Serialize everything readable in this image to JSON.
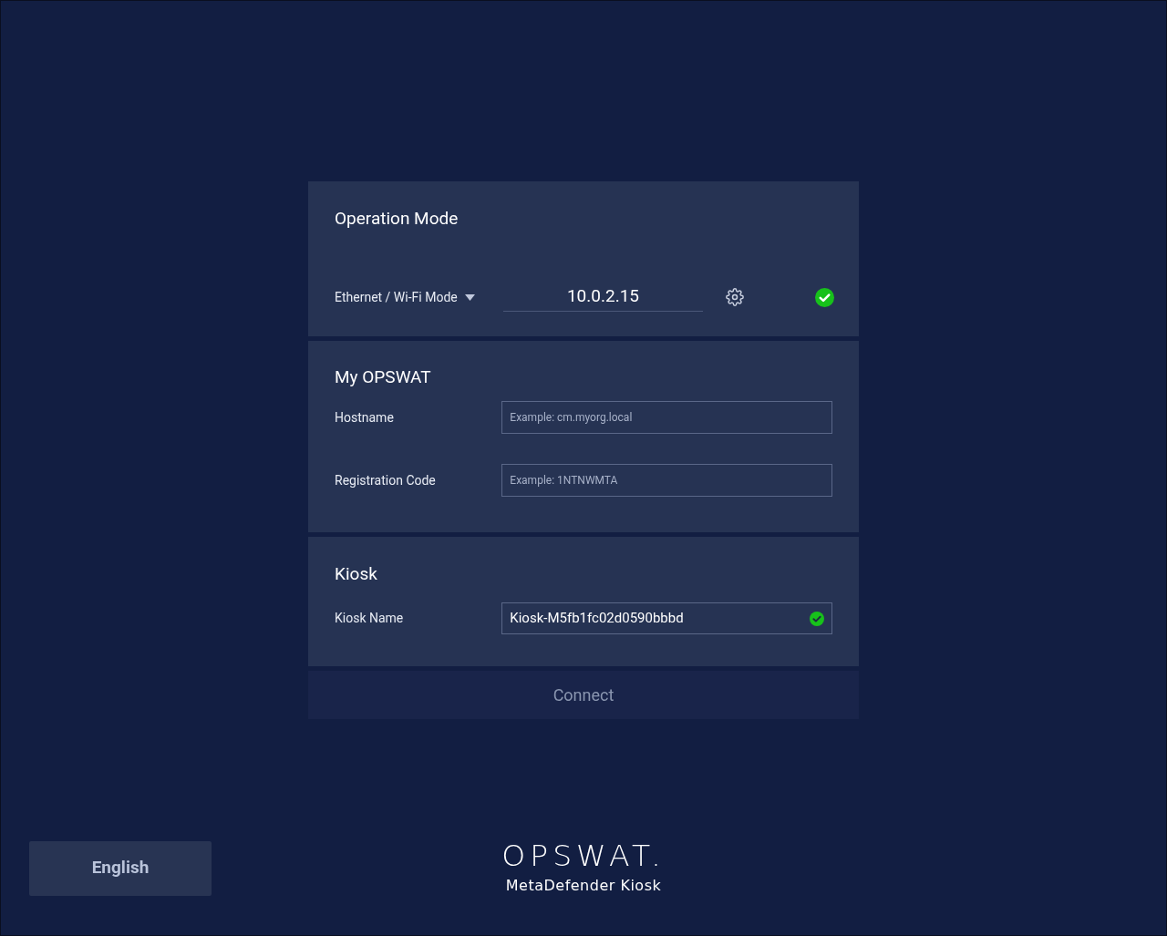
{
  "operation_mode": {
    "title": "Operation Mode",
    "mode": "Ethernet / Wi-Fi Mode",
    "ip_address": "10.0.2.15",
    "valid": true
  },
  "my_opswat": {
    "title": "My OPSWAT",
    "fields": [
      {
        "label": "Hostname",
        "placeholder": "Example: cm.myorg.local"
      },
      {
        "label": "Registration Code",
        "placeholder": "Example: 1NTNWMTA"
      }
    ]
  },
  "kiosk": {
    "title": "Kiosk",
    "fields": [
      {
        "label": "Kiosk Name",
        "value": "Kiosk-M5fb1fc02d0590bbbd",
        "valid": true
      }
    ]
  },
  "connect_button": {
    "label": "Connect",
    "disabled": true
  },
  "language_button": "English",
  "logo": {
    "brand": "OPSWAT.",
    "product": "MetaDefender Kiosk"
  }
}
